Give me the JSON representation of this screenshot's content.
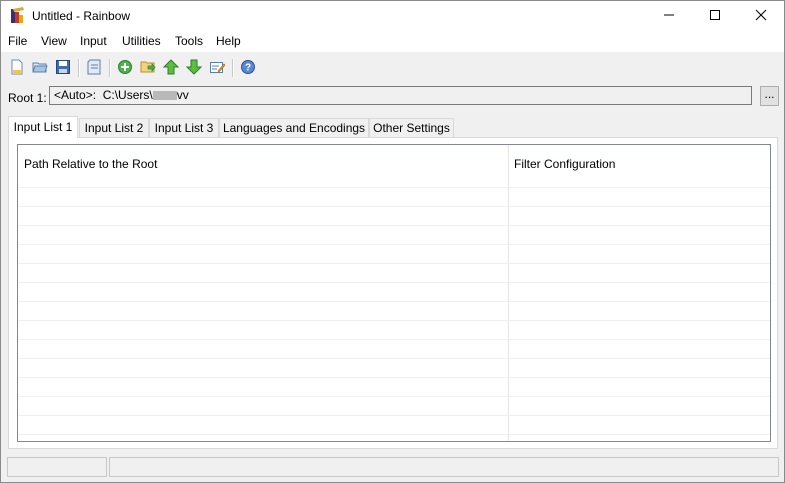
{
  "window": {
    "title": "Untitled - Rainbow"
  },
  "menu": [
    "File",
    "View",
    "Input",
    "Utilities",
    "Tools",
    "Help"
  ],
  "toolbar": {
    "icons": [
      "new-icon",
      "open-icon",
      "save-icon",
      "document-icon",
      "add-icon",
      "add-folder-icon",
      "move-up-icon",
      "move-down-icon",
      "edit-icon",
      "help-icon"
    ]
  },
  "root": {
    "label": "Root 1:",
    "value_prefix": "<Auto>:  C:\\Users\\",
    "value_suffix": "vv",
    "browse_label": "..."
  },
  "tabs": [
    "Input List 1",
    "Input List 2",
    "Input List 3",
    "Languages and Encodings",
    "Other Settings"
  ],
  "grid": {
    "columns": [
      "Path Relative to the Root",
      "Filter Configuration"
    ],
    "rows": []
  },
  "colors": {
    "background": "#f0f0f0",
    "titlebar": "#ffffff",
    "grid_border": "#828790"
  }
}
